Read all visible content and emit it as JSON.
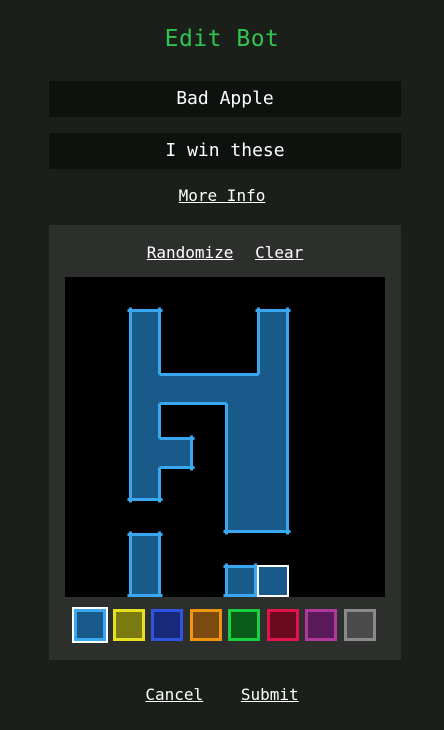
{
  "app": {
    "title": "Edit Bot"
  },
  "form": {
    "name_value": "Bad Apple",
    "tagline_value": "I win these",
    "more_info_label": "More Info"
  },
  "editor": {
    "randomize_label": "Randomize",
    "clear_label": "Clear",
    "grid_size": 10,
    "cells": [
      {
        "c": 2,
        "r": 1
      },
      {
        "c": 2,
        "r": 2
      },
      {
        "c": 2,
        "r": 3
      },
      {
        "c": 2,
        "r": 4
      },
      {
        "c": 2,
        "r": 5
      },
      {
        "c": 2,
        "r": 6
      },
      {
        "c": 3,
        "r": 3
      },
      {
        "c": 3,
        "r": 5
      },
      {
        "c": 4,
        "r": 3
      },
      {
        "c": 5,
        "r": 3
      },
      {
        "c": 5,
        "r": 4
      },
      {
        "c": 5,
        "r": 5
      },
      {
        "c": 5,
        "r": 6
      },
      {
        "c": 5,
        "r": 7
      },
      {
        "c": 6,
        "r": 1
      },
      {
        "c": 6,
        "r": 2
      },
      {
        "c": 6,
        "r": 3
      },
      {
        "c": 6,
        "r": 4
      },
      {
        "c": 6,
        "r": 5
      },
      {
        "c": 6,
        "r": 6
      },
      {
        "c": 6,
        "r": 7
      },
      {
        "c": 2,
        "r": 8
      },
      {
        "c": 2,
        "r": 9
      },
      {
        "c": 5,
        "r": 9
      }
    ],
    "cursor_cell": {
      "c": 6,
      "r": 9
    },
    "cell_fill": "#1a5a8a",
    "cell_stroke": "#3aa8f0",
    "cursor_stroke": "#ffffff",
    "palette": [
      {
        "name": "blue",
        "fill": "#1a5a8a",
        "border": "#3aa8f0",
        "selected": true
      },
      {
        "name": "yellow",
        "fill": "#7a7a10",
        "border": "#e6e020",
        "selected": false
      },
      {
        "name": "navy",
        "fill": "#1a2a7a",
        "border": "#2f55e0",
        "selected": false
      },
      {
        "name": "orange",
        "fill": "#7a4a10",
        "border": "#f0960c",
        "selected": false
      },
      {
        "name": "green",
        "fill": "#0a5a1a",
        "border": "#1ad040",
        "selected": false
      },
      {
        "name": "crimson",
        "fill": "#6a0a20",
        "border": "#e01448",
        "selected": false
      },
      {
        "name": "purple",
        "fill": "#5a1a5a",
        "border": "#b0389a",
        "selected": false
      },
      {
        "name": "gray",
        "fill": "#4a4a4a",
        "border": "#8a8a8a",
        "selected": false
      }
    ]
  },
  "actions": {
    "cancel_label": "Cancel",
    "submit_label": "Submit"
  }
}
